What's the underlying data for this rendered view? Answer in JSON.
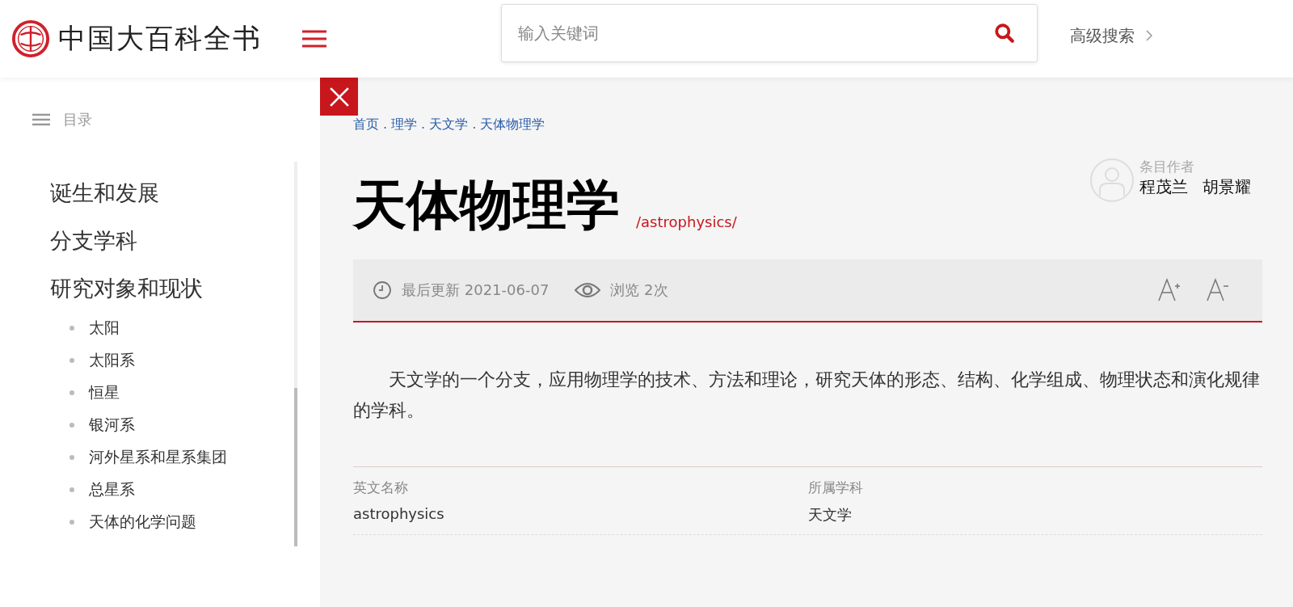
{
  "header": {
    "logo_text": "中国大百科全书",
    "search": {
      "placeholder": "输入关键词"
    },
    "advanced_search": "高级搜索"
  },
  "toc": {
    "title": "目录",
    "items": [
      {
        "label": "诞生和发展"
      },
      {
        "label": "分支学科"
      },
      {
        "label": "研究对象和现状",
        "children": [
          {
            "label": "太阳"
          },
          {
            "label": "太阳系"
          },
          {
            "label": "恒星"
          },
          {
            "label": "银河系"
          },
          {
            "label": "河外星系和星系集团"
          },
          {
            "label": "总星系"
          },
          {
            "label": "天体的化学问题"
          }
        ]
      }
    ]
  },
  "breadcrumb": [
    "首页",
    "理学",
    "天文学",
    "天体物理学"
  ],
  "breadcrumb_separator": ".",
  "article": {
    "title": "天体物理学",
    "english": "/astrophysics/",
    "author_label": "条目作者",
    "authors": [
      "程茂兰",
      "胡景耀"
    ],
    "updated": "最后更新 2021-06-07",
    "views": "浏览 2次",
    "summary": "天文学的一个分支，应用物理学的技术、方法和理论，研究天体的形态、结构、化学组成、物理状态和演化规律的学科。",
    "info": [
      {
        "label": "英文名称",
        "value": "astrophysics"
      },
      {
        "label": "所属学科",
        "value": "天文学"
      }
    ]
  }
}
